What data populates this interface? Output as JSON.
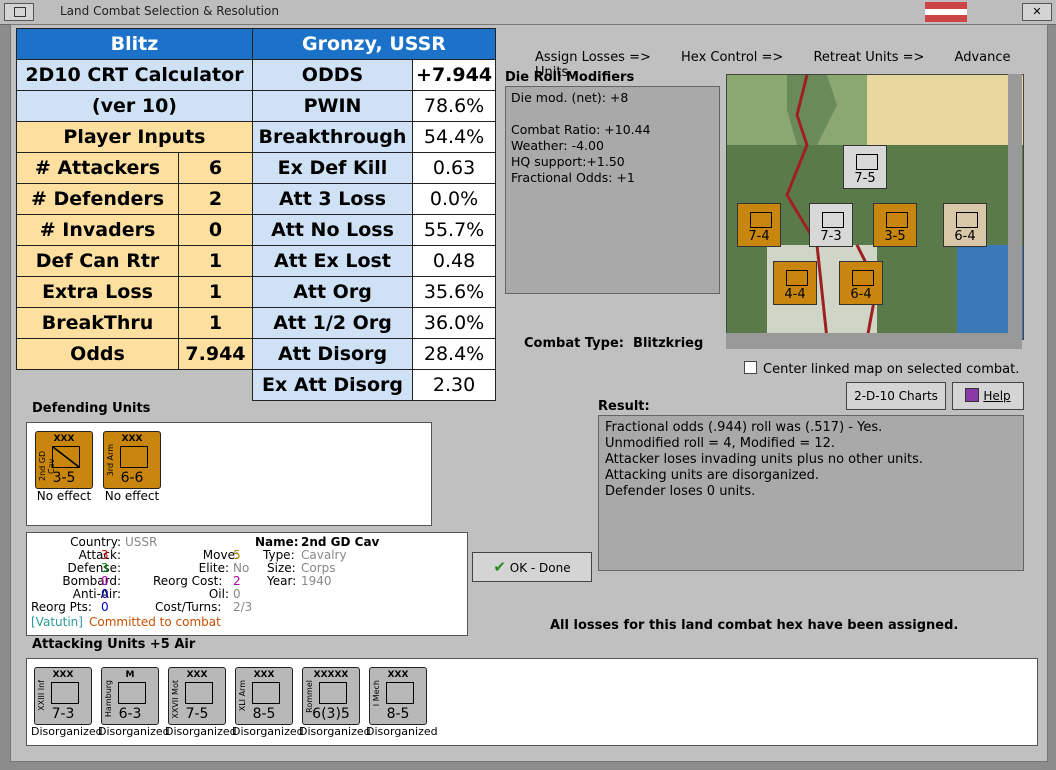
{
  "window": {
    "title": "Land Combat Selection & Resolution",
    "close_glyph": "✕"
  },
  "steps": [
    "Assign Losses =>",
    "Hex Control =>",
    "Retreat Units =>",
    "Advance Units"
  ],
  "calc": {
    "left_header": "Blitz",
    "right_header": "Gronzy, USSR",
    "title1": "2D10 CRT Calculator",
    "title2": "(ver 10)",
    "inputs_header": "Player Inputs",
    "inputs": [
      {
        "label": "# Attackers",
        "value": "6"
      },
      {
        "label": "# Defenders",
        "value": "2"
      },
      {
        "label": "# Invaders",
        "value": "0"
      },
      {
        "label": "Def Can Rtr",
        "value": "1"
      },
      {
        "label": "Extra Loss",
        "value": "1"
      },
      {
        "label": "BreakThru",
        "value": "1"
      },
      {
        "label": "Odds",
        "value": "7.944"
      }
    ],
    "results": [
      {
        "label": "ODDS",
        "value": "+7.944"
      },
      {
        "label": "PWIN",
        "value": "78.6%"
      },
      {
        "label": "Breakthrough",
        "value": "54.4%"
      },
      {
        "label": "Ex Def Kill",
        "value": "0.63"
      },
      {
        "label": "Att 3 Loss",
        "value": "0.0%"
      },
      {
        "label": "Att No Loss",
        "value": "55.7%"
      },
      {
        "label": "Att Ex Lost",
        "value": "0.48"
      },
      {
        "label": "Att Org",
        "value": "35.6%"
      },
      {
        "label": "Att 1/2 Org",
        "value": "36.0%"
      },
      {
        "label": "Att Disorg",
        "value": "28.4%"
      },
      {
        "label": "Ex Att Disorg",
        "value": "2.30"
      }
    ]
  },
  "die_roll": {
    "header": "Die Roll Modifiers",
    "lines": [
      "Die mod. (net): +8",
      "",
      "Combat Ratio: +10.44",
      "Weather: -4.00",
      "HQ support:+1.50",
      "Fractional Odds: +1"
    ]
  },
  "combat_type": {
    "label": "Combat Type:",
    "value": "Blitzkrieg"
  },
  "center_map": "Center linked map on selected combat.",
  "buttons": {
    "charts": "2-D-10 Charts",
    "help": "Help",
    "ok": "OK - Done"
  },
  "result": {
    "header": "Result:",
    "lines": [
      "Fractional odds (.944) roll was (.517)  - Yes.",
      "Unmodified roll = 4, Modified = 12.",
      "Attacker loses invading units plus no other units.",
      "Attacking units are disorganized.",
      "Defender loses 0 units."
    ]
  },
  "defending": {
    "header": "Defending Units",
    "units": [
      {
        "name": "2nd GD Cav",
        "size": "XXX",
        "value": "3-5",
        "status": "No effect"
      },
      {
        "name": "3rd Arm",
        "size": "XXX",
        "value": "6-6",
        "status": "No effect"
      }
    ]
  },
  "info": {
    "country_label": "Country:",
    "country": "USSR",
    "attack_label": "Attack:",
    "attack": "3",
    "defense_label": "Defense:",
    "defense": "3",
    "bombard_label": "Bombard:",
    "bombard": "0",
    "antiair_label": "Anti-Air:",
    "antiair": "0",
    "reorg_label": "Reorg Pts:",
    "reorg": "0",
    "move_label": "Move:",
    "move": "5",
    "elite_label": "Elite:",
    "elite": "No",
    "reorgcost_label": "Reorg Cost:",
    "reorgcost": "2",
    "oil_label": "Oil:",
    "oil": "0",
    "costturns_label": "Cost/Turns:",
    "costturns": "2/3",
    "name_label": "Name:",
    "name": "2nd GD Cav",
    "type_label": "Type:",
    "type": "Cavalry",
    "size_label": "Size:",
    "size": "Corps",
    "year_label": "Year:",
    "year": "1940",
    "hq": "[Vatutin]",
    "committed": "Committed to combat"
  },
  "losses_msg": "All losses for this land combat hex have been assigned.",
  "attacking": {
    "header": "Attacking Units +5 Air",
    "units": [
      {
        "name": "XXIII Inf",
        "size": "XXX",
        "value": "7-3",
        "status": "Disorganized"
      },
      {
        "name": "Hamburg",
        "size": "M",
        "value": "6-3",
        "status": "Disorganized"
      },
      {
        "name": "XXVII Mot",
        "size": "XXX",
        "value": "7-5",
        "status": "Disorganized"
      },
      {
        "name": "XLI Arm",
        "size": "XXX",
        "value": "8-5",
        "status": "Disorganized"
      },
      {
        "name": "Rommel",
        "size": "XXXXX",
        "value": "6(3)5",
        "status": "Disorganized"
      },
      {
        "name": "I Mech",
        "size": "XXX",
        "value": "8-5",
        "status": "Disorganized"
      }
    ]
  },
  "map_counters": [
    {
      "v": "7-4",
      "c": "#c8860e"
    },
    {
      "v": "7-3",
      "c": "#d8d8d8"
    },
    {
      "v": "3-5",
      "c": "#c8860e"
    },
    {
      "v": "6-4",
      "c": "#d8c8a8"
    },
    {
      "v": "4-4",
      "c": "#c8860e"
    },
    {
      "v": "6-4",
      "c": "#c8860e"
    },
    {
      "v": "7-5",
      "c": "#d8d8d8"
    }
  ],
  "colors": {
    "blue": "#1c72c8",
    "light_blue": "#cfe1f5",
    "yellow": "#fde0a0",
    "counter_orange": "#c8860e",
    "counter_grey": "#b8b8b8"
  }
}
